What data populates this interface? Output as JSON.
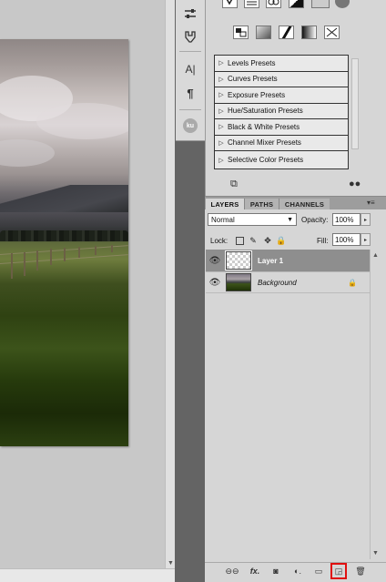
{
  "adjustments": {
    "presets": [
      "Levels Presets",
      "Curves Presets",
      "Exposure Presets",
      "Hue/Saturation Presets",
      "Black & White Presets",
      "Channel Mixer Presets",
      "Selective Color Presets"
    ]
  },
  "layers_panel": {
    "tabs": [
      "LAYERS",
      "PATHS",
      "CHANNELS"
    ],
    "active_tab": "LAYERS",
    "blend_mode": "Normal",
    "opacity_label": "Opacity:",
    "opacity_value": "100%",
    "lock_label": "Lock:",
    "fill_label": "Fill:",
    "fill_value": "100%",
    "layers": [
      {
        "name": "Layer 1",
        "selected": true,
        "visible": true,
        "thumbnail": "transparent"
      },
      {
        "name": "Background",
        "selected": false,
        "visible": true,
        "thumbnail": "photo",
        "locked": true
      }
    ],
    "bottom_icons": [
      "link-icon",
      "fx-icon",
      "mask-icon",
      "adjustment-layer-icon",
      "group-folder-icon",
      "new-layer-icon",
      "trash-icon"
    ],
    "highlight_color": "#e01010"
  },
  "dock": {
    "icons": [
      "adjustments-sliders-icon",
      "clone-source-icon",
      "character-icon",
      "paragraph-icon",
      "kuler-icon"
    ],
    "character_glyph": "A|",
    "paragraph_glyph": "¶",
    "kuler_label": "ku"
  }
}
